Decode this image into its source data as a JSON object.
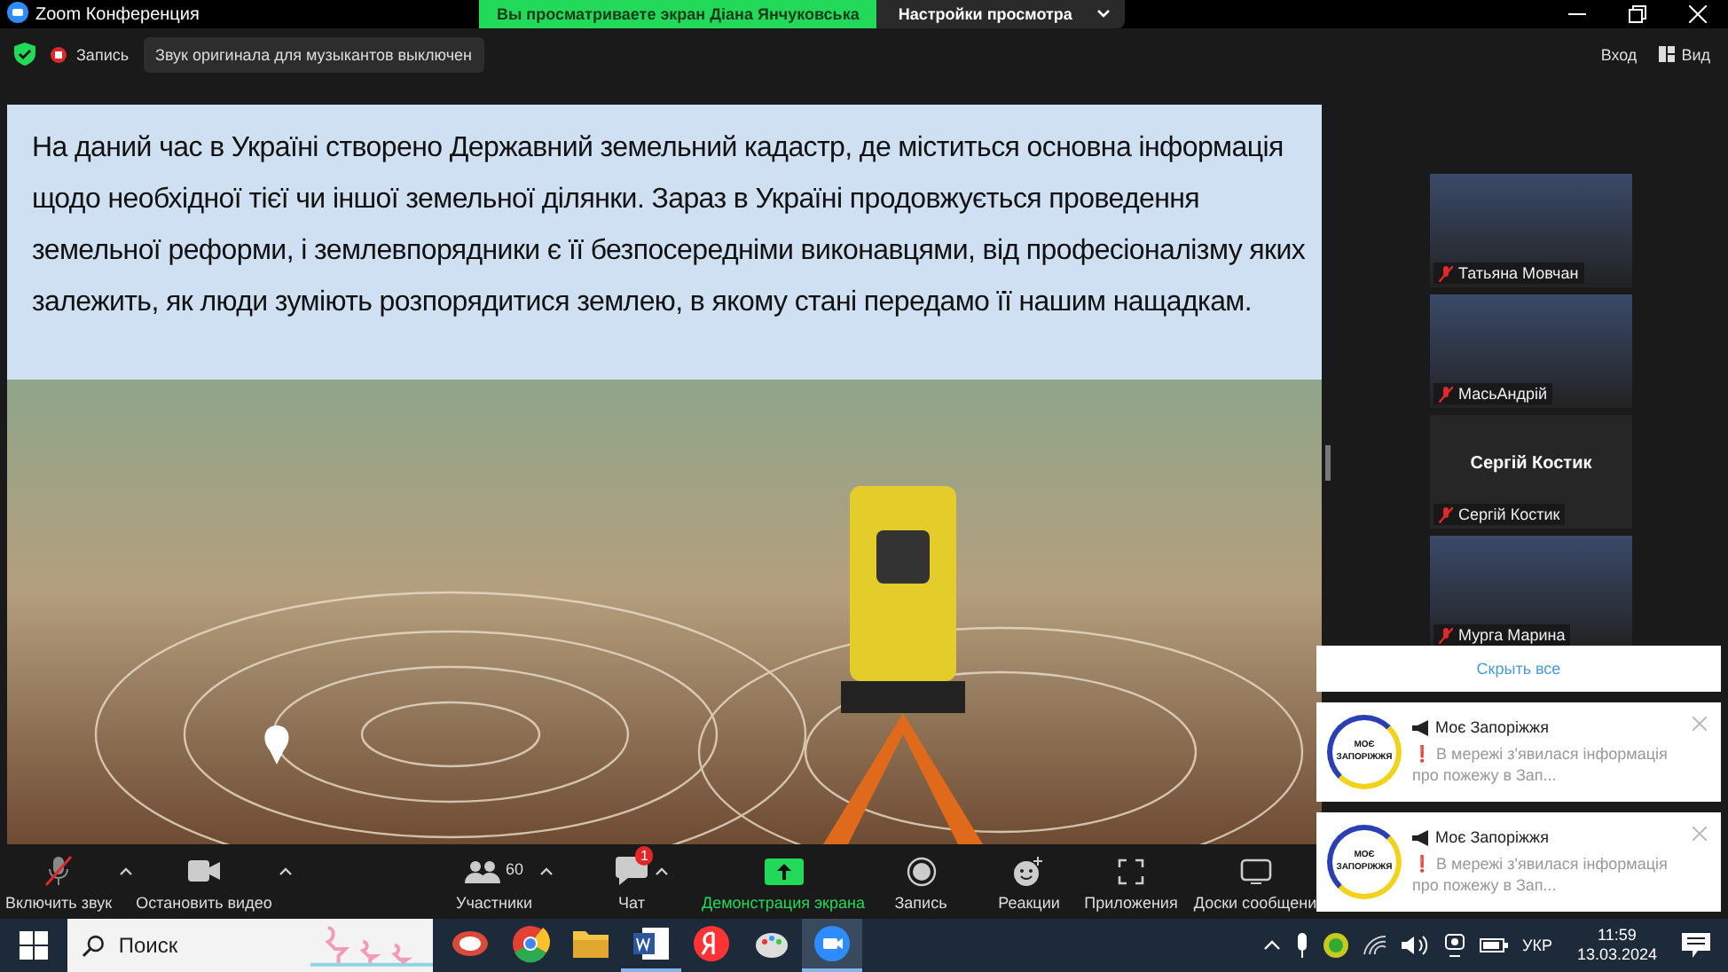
{
  "window": {
    "title": "Zoom Конференция"
  },
  "share_banner": {
    "text": "Вы просматриваете экран Діана Янчуковська",
    "options_button": "Настройки просмотра"
  },
  "meeting_bar": {
    "recording": "Запись",
    "original_sound": "Звук оригинала для музыкантов выключен",
    "enter": "Вход",
    "view": "Вид"
  },
  "slide": {
    "text": "На даний час в Україні створено Державний земельний кадастр, де міститься основна інформація щодо необхідної тієї чи іншої земельної ділянки. Зараз в Україні продовжується проведення земельної реформи, і землевпорядники є її безпосередніми виконавцями, від професіоналізму яких залежить, як люди зуміють розпорядитися землею, в якому стані передамо її нашим нащадкам."
  },
  "participants": [
    {
      "name": "Татьяна Мовчан",
      "kind": "video",
      "muted": true
    },
    {
      "name": "МасьАндрій",
      "kind": "video",
      "muted": true
    },
    {
      "name": "Сергій Костик",
      "kind": "name",
      "display": "Сергій Костик",
      "muted": true
    },
    {
      "name": "Мурга Марина",
      "kind": "video",
      "muted": true
    }
  ],
  "notifications": {
    "hide_all": "Скрыть все",
    "items": [
      {
        "title": "Моє Запоріжжя",
        "logo": "МОЄ ЗАПОРІЖЖЯ",
        "mark": "❗",
        "text": "В мережі з'явилася інформація про пожежу в Зап..."
      },
      {
        "title": "Моє Запоріжжя",
        "logo": "МОЄ ЗАПОРІЖЖЯ",
        "mark": "❗",
        "text": "В мережі з'явилася інформація про пожежу в Зап..."
      }
    ]
  },
  "toolbar": [
    {
      "kind": "mic",
      "label": "Включить звук",
      "caret": true
    },
    {
      "kind": "video",
      "label": "Остановить видео",
      "caret": true
    },
    {
      "kind": "participants",
      "label": "Участники",
      "count": "60",
      "caret": true
    },
    {
      "kind": "chat",
      "label": "Чат",
      "badge": "1",
      "caret": true
    },
    {
      "kind": "share",
      "label": "Демонстрация экрана",
      "caret": false
    },
    {
      "kind": "record",
      "label": "Запись",
      "caret": false
    },
    {
      "kind": "reactions",
      "label": "Реакции",
      "caret": false
    },
    {
      "kind": "apps",
      "label": "Приложения",
      "caret": false
    },
    {
      "kind": "whiteboard",
      "label": "Доски сообщени",
      "caret": false
    }
  ],
  "taskbar": {
    "search_placeholder": "Поиск",
    "apps": [
      {
        "kind": "paint",
        "selected": false
      },
      {
        "kind": "chrome",
        "selected": false
      },
      {
        "kind": "folder",
        "selected": false
      },
      {
        "kind": "word",
        "selected": true
      },
      {
        "kind": "yandex",
        "selected": false
      },
      {
        "kind": "palette",
        "selected": false
      },
      {
        "kind": "zoom",
        "selected": true
      }
    ],
    "language": "УКР",
    "time": "11:59",
    "date": "13.03.2024"
  }
}
